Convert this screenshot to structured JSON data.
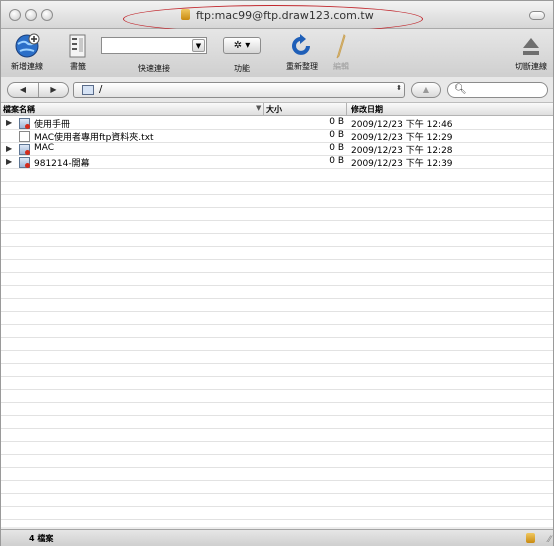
{
  "window": {
    "title": "ftp:mac99@ftp.draw123.com.tw"
  },
  "toolbar": {
    "new_connection": "新增連線",
    "bookmarks": "書籤",
    "quick_connect": "快速連接",
    "functions": "功能",
    "refresh": "重新整理",
    "edit": "編輯",
    "disconnect": "切斷連線",
    "quick_connect_value": ""
  },
  "pathbar": {
    "path": "/",
    "search_placeholder": ""
  },
  "list": {
    "columns": {
      "name": "檔案名稱",
      "size": "大小",
      "modified": "修改日期"
    },
    "items": [
      {
        "name": "使用手冊",
        "size": "0 B",
        "modified": "2009/12/23 下午 12:46",
        "kind": "folder"
      },
      {
        "name": "MAC使用者專用ftp資料夾.txt",
        "size": "0 B",
        "modified": "2009/12/23 下午 12:29",
        "kind": "file"
      },
      {
        "name": "MAC",
        "size": "0 B",
        "modified": "2009/12/23 下午 12:28",
        "kind": "folder"
      },
      {
        "name": "981214-開幕",
        "size": "0 B",
        "modified": "2009/12/23 下午 12:39",
        "kind": "folder"
      }
    ]
  },
  "status": {
    "count": "4 檔案"
  },
  "colors": {
    "highlight_oval": "#c1272d"
  }
}
